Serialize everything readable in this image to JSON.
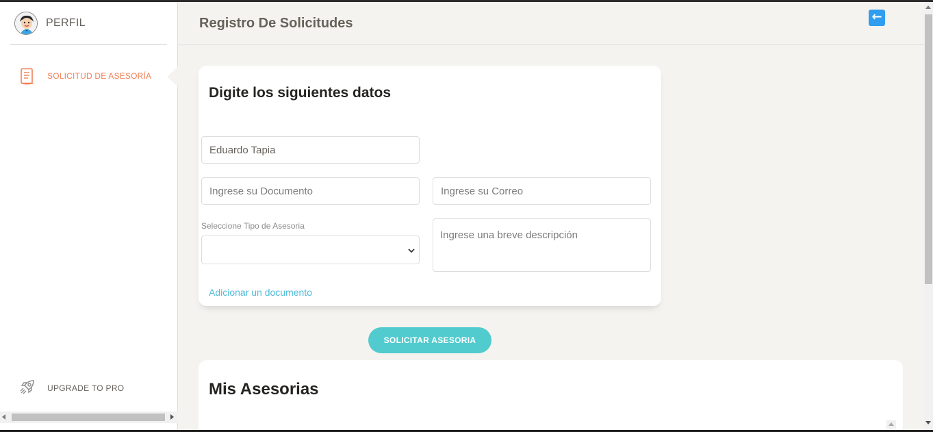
{
  "sidebar": {
    "profile_label": "PERFIL",
    "nav_items": [
      {
        "label": "SOLICITUD DE ASESORÍA",
        "icon": "document-icon",
        "active": true
      }
    ],
    "upgrade_label": "UPGRADE TO PRO",
    "upgrade_icon": "rocket-icon"
  },
  "header": {
    "title": "Registro De Solicitudes",
    "back_icon": "back-arrow-icon"
  },
  "form": {
    "title": "Digite los siguientes datos",
    "name_value": "Eduardo Tapia",
    "document_placeholder": "Ingrese su Documento",
    "email_placeholder": "Ingrese su Correo",
    "type_label": "Seleccione Tipo de Asesoria",
    "type_value": "",
    "description_placeholder": "Ingrese una breve descripción",
    "add_document_link": "Adicionar un documento",
    "submit_label": "SOLICITAR ASESORIA"
  },
  "list": {
    "title": "Mis Asesorias"
  },
  "colors": {
    "active_nav": "#ef8157",
    "primary_button": "#51cbce",
    "link": "#51bcda",
    "back_button": "#2f9df0",
    "background": "#f4f3ef"
  }
}
